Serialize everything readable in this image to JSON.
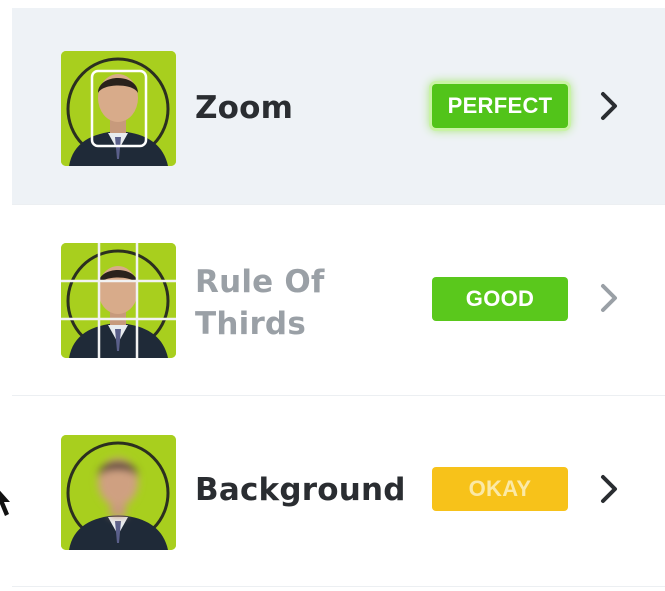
{
  "items": [
    {
      "label": "Zoom",
      "badge": "PERFECT",
      "badge_color": "#52c41a",
      "thumbnail_icon": "portrait-zoom-frame-icon",
      "chevron_icon": "chevron-right-icon"
    },
    {
      "label_lines": [
        "Rule Of",
        "Thirds"
      ],
      "badge": "GOOD",
      "badge_color": "#5ac81c",
      "thumbnail_icon": "portrait-thirds-grid-icon",
      "chevron_icon": "chevron-right-icon"
    },
    {
      "label": "Background",
      "badge": "OKAY",
      "badge_color": "#f7c21a",
      "thumbnail_icon": "portrait-blurred-face-icon",
      "chevron_icon": "chevron-right-icon"
    }
  ],
  "colors": {
    "selected_row_bg": "#eef2f6",
    "thumbnail_bg": "#a8cf1e",
    "label_text": "#2a2d31",
    "muted_label_text": "#9aa0a6"
  }
}
